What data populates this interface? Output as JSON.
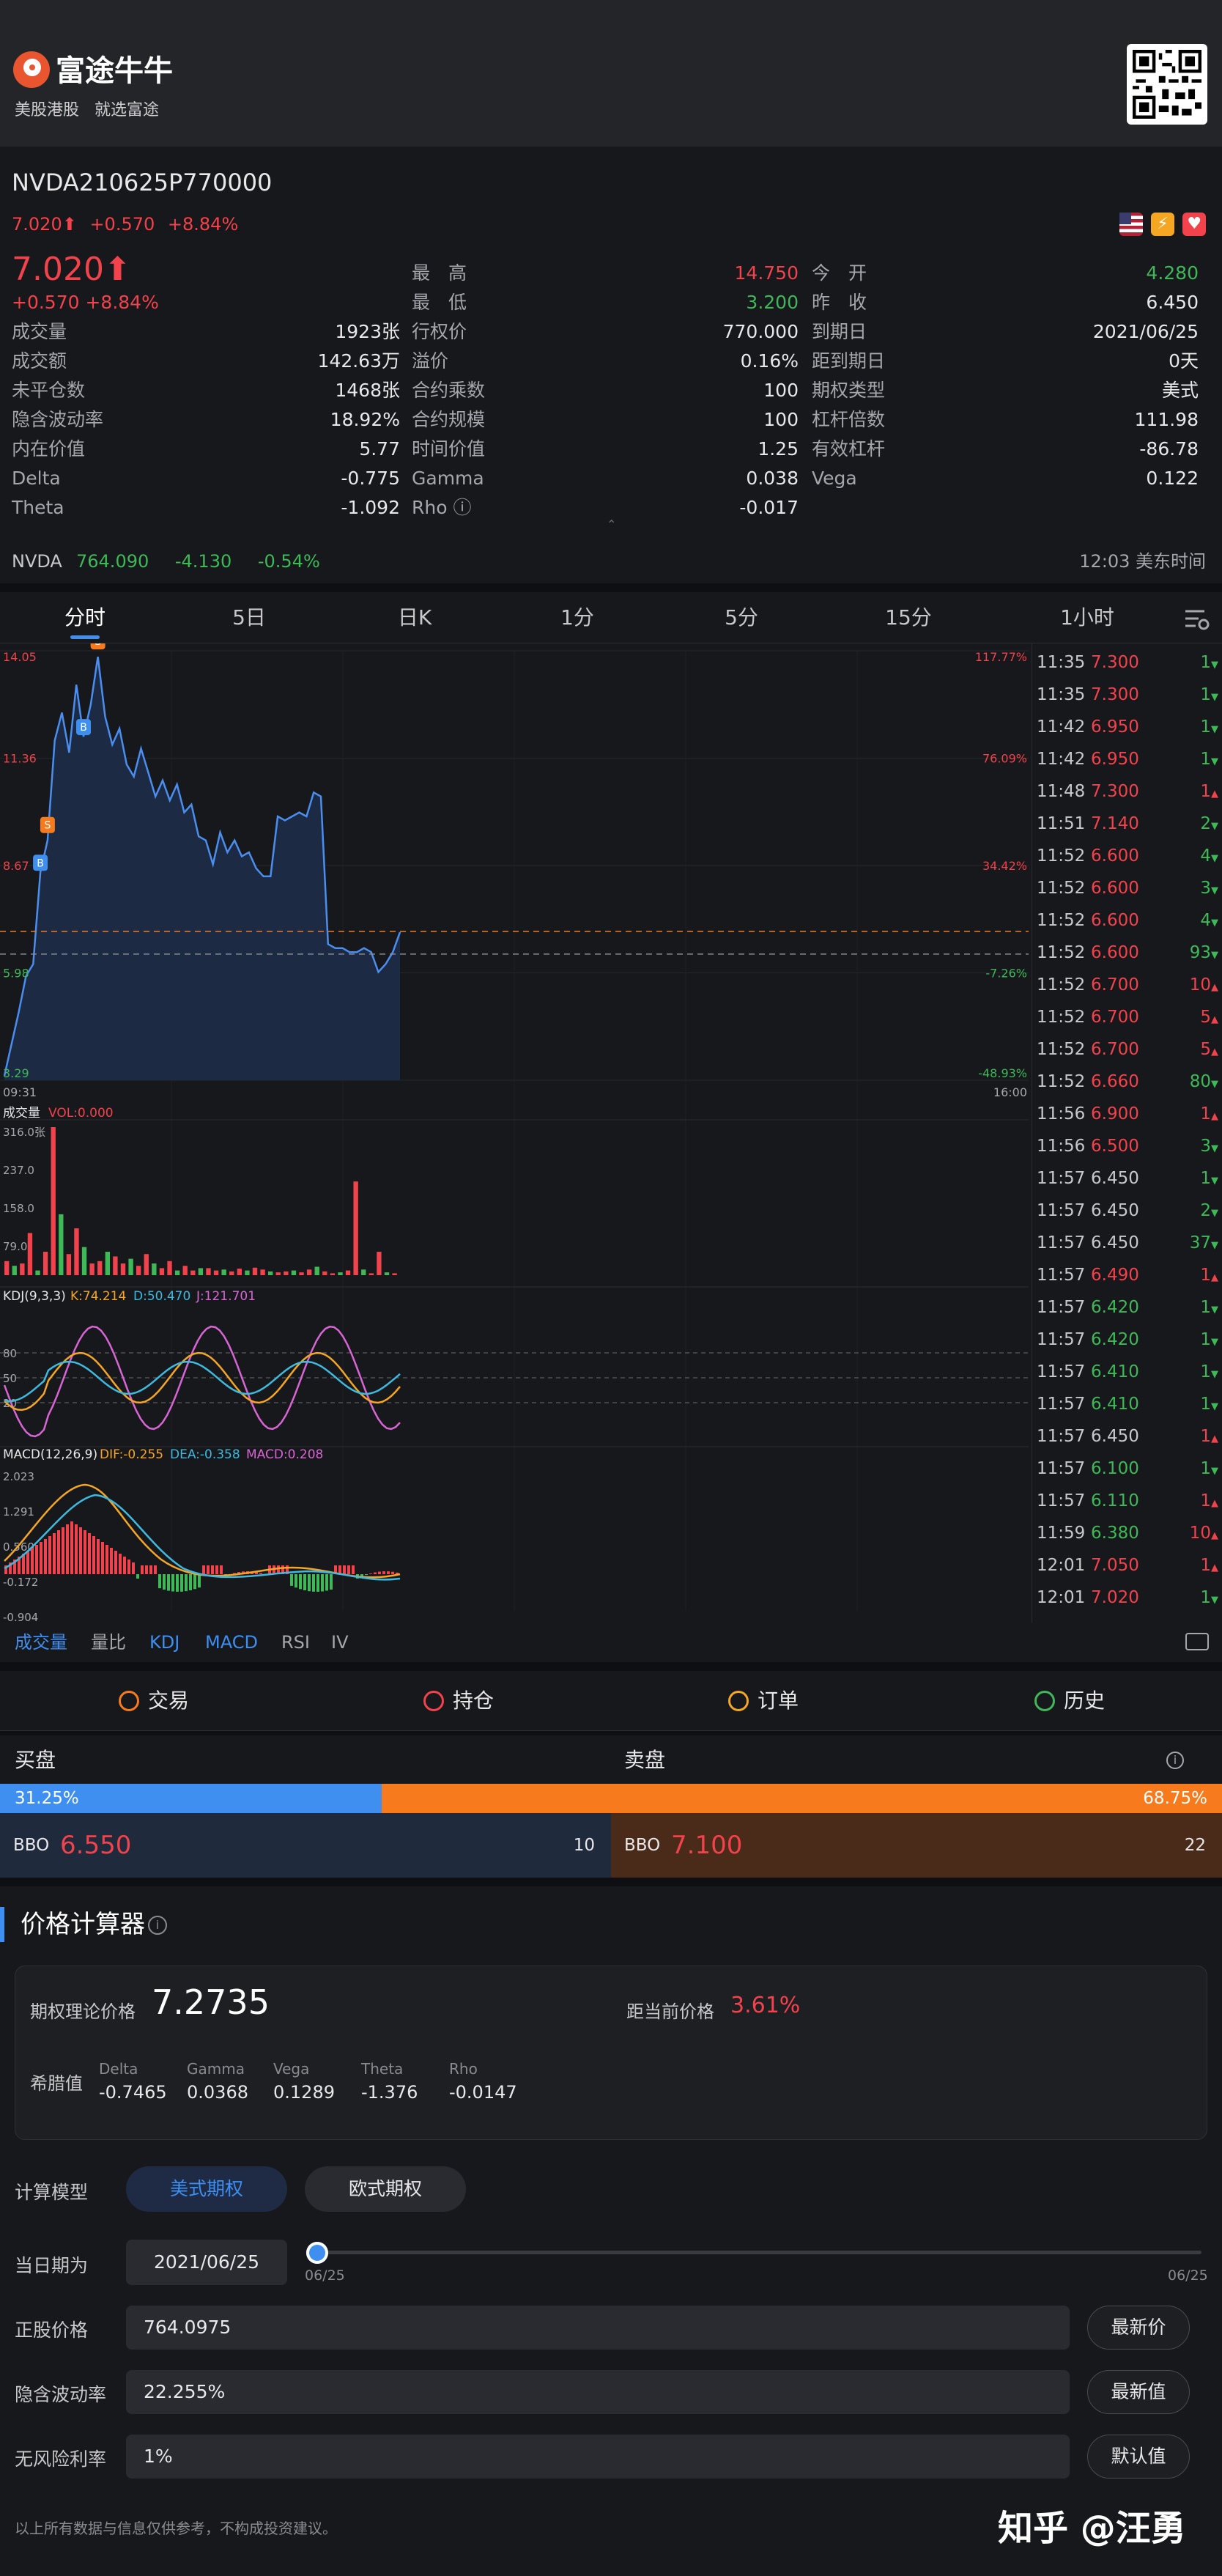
{
  "banner": {
    "brand": "富途牛牛",
    "slogan": "美股港股  就选富途"
  },
  "symbol": {
    "name": "NVDA210625P770000",
    "last_line": "7.020⬆  +0.570  +8.84%",
    "price": "7.020⬆",
    "change": "+0.570 +8.84%"
  },
  "stats": {
    "col1": [
      {
        "label": "成交量",
        "value": "1923张"
      },
      {
        "label": "成交额",
        "value": "142.63万"
      },
      {
        "label": "未平仓数",
        "value": "1468张"
      },
      {
        "label": "隐含波动率",
        "value": "18.92%"
      },
      {
        "label": "内在价值",
        "value": "5.77"
      },
      {
        "label": "Delta",
        "value": "-0.775"
      },
      {
        "label": "Theta",
        "value": "-1.092"
      }
    ],
    "col2": [
      {
        "label": "最　高",
        "value": "14.750",
        "color": "#f2424b"
      },
      {
        "label": "最　低",
        "value": "3.200",
        "color": "#3fb858"
      },
      {
        "label": "行权价",
        "value": "770.000"
      },
      {
        "label": "溢价",
        "value": "0.16%"
      },
      {
        "label": "合约乘数",
        "value": "100"
      },
      {
        "label": "合约规模",
        "value": "100"
      },
      {
        "label": "时间价值",
        "value": "1.25"
      },
      {
        "label": "Gamma",
        "value": "0.038"
      },
      {
        "label": "Rho ⓘ",
        "value": "-0.017"
      }
    ],
    "col3": [
      {
        "label": "今　开",
        "value": "4.280",
        "color": "#3fb858"
      },
      {
        "label": "昨　收",
        "value": "6.450"
      },
      {
        "label": "到期日",
        "value": "2021/06/25"
      },
      {
        "label": "距到期日",
        "value": "0天"
      },
      {
        "label": "期权类型",
        "value": "美式"
      },
      {
        "label": "杠杆倍数",
        "value": "111.98"
      },
      {
        "label": "有效杠杆",
        "value": "-86.78"
      },
      {
        "label": "Vega",
        "value": "0.122"
      }
    ]
  },
  "underlying": {
    "symbol": "NVDA",
    "quote": "764.090  -4.130  -0.54%",
    "time": "12:03 美东时间"
  },
  "chart_tabs": [
    "分时",
    "5日",
    "日K",
    "1分",
    "5分",
    "15分",
    "1小时"
  ],
  "indicator_tabs": [
    "成交量",
    "量比",
    "KDJ",
    "MACD",
    "RSI",
    "IV"
  ],
  "chart_data": {
    "type": "line",
    "title": "",
    "x_range": [
      "09:31",
      "16:00"
    ],
    "price_axis": [
      "14.05",
      "11.36",
      "8.67",
      "5.98",
      "3.29"
    ],
    "pct_axis": [
      "117.77%",
      "76.09%",
      "34.42%",
      "-7.26%",
      "-48.93%"
    ],
    "prev_close": 6.45,
    "series": [
      {
        "values": [
          3.4,
          4.2,
          5.0,
          5.9,
          6.2,
          8.5,
          9.3,
          11.8,
          12.5,
          11.5,
          13.2,
          11.9,
          12.7,
          13.9,
          12.4,
          11.7,
          12.1,
          11.2,
          10.9,
          11.6,
          11.0,
          10.4,
          10.8,
          10.3,
          10.7,
          10.0,
          10.2,
          9.4,
          9.3,
          8.7,
          9.5,
          9.0,
          9.3,
          8.9,
          9.0,
          8.6,
          8.4,
          8.4,
          9.9,
          9.8,
          9.9,
          10.0,
          9.9,
          10.5,
          10.4,
          6.7,
          6.6,
          6.6,
          6.5,
          6.5,
          6.6,
          6.5,
          6.0,
          6.2,
          6.5,
          7.0
        ]
      }
    ],
    "markers": [
      {
        "label": "S",
        "color": "#f77a1c"
      },
      {
        "label": "B",
        "color": "#3e8ff0"
      },
      {
        "label": "S",
        "color": "#f77a1c"
      },
      {
        "label": "B",
        "color": "#3e8ff0"
      }
    ],
    "volume": {
      "label": "成交量",
      "vol_label": "VOL:0.000",
      "axis": [
        "316.0张",
        "237.0",
        "158.0",
        "79.0"
      ],
      "values": [
        30,
        20,
        25,
        90,
        10,
        50,
        316,
        130,
        45,
        100,
        60,
        25,
        30,
        50,
        40,
        25,
        35,
        20,
        45,
        25,
        15,
        30,
        10,
        20,
        10,
        15,
        15,
        10,
        12,
        8,
        14,
        10,
        16,
        12,
        8,
        6,
        8,
        10,
        6,
        12,
        18,
        8,
        4,
        6,
        10,
        200,
        12,
        4,
        50,
        6,
        4
      ]
    },
    "kdj": {
      "label": "KDJ(9,3,3)",
      "k": "K:74.214",
      "d": "D:50.470",
      "j": "J:121.701",
      "axis": [
        "80",
        "50",
        "20"
      ]
    },
    "macd": {
      "label": "MACD(12,26,9)",
      "dif": "DIF:-0.255",
      "dea": "DEA:-0.358",
      "macd": "MACD:0.208",
      "axis": [
        "2.023",
        "1.291",
        "0.560",
        "-0.172",
        "-0.904"
      ]
    }
  },
  "trades": [
    [
      "11:35",
      "7.300",
      "1",
      "down"
    ],
    [
      "11:35",
      "7.300",
      "1",
      "down"
    ],
    [
      "11:42",
      "6.950",
      "1",
      "down"
    ],
    [
      "11:42",
      "6.950",
      "1",
      "down"
    ],
    [
      "11:48",
      "7.300",
      "1",
      "up"
    ],
    [
      "11:51",
      "7.140",
      "2",
      "down"
    ],
    [
      "11:52",
      "6.600",
      "4",
      "down"
    ],
    [
      "11:52",
      "6.600",
      "3",
      "down"
    ],
    [
      "11:52",
      "6.600",
      "4",
      "down"
    ],
    [
      "11:52",
      "6.600",
      "93",
      "down"
    ],
    [
      "11:52",
      "6.700",
      "10",
      "up"
    ],
    [
      "11:52",
      "6.700",
      "5",
      "up"
    ],
    [
      "11:52",
      "6.700",
      "5",
      "up"
    ],
    [
      "11:52",
      "6.660",
      "80",
      "down"
    ],
    [
      "11:56",
      "6.900",
      "1",
      "up"
    ],
    [
      "11:56",
      "6.500",
      "3",
      "down"
    ],
    [
      "11:57",
      "6.450",
      "1",
      "down"
    ],
    [
      "11:57",
      "6.450",
      "2",
      "down"
    ],
    [
      "11:57",
      "6.450",
      "37",
      "down"
    ],
    [
      "11:57",
      "6.490",
      "1",
      "up"
    ],
    [
      "11:57",
      "6.420",
      "1",
      "down"
    ],
    [
      "11:57",
      "6.420",
      "1",
      "down"
    ],
    [
      "11:57",
      "6.410",
      "1",
      "down"
    ],
    [
      "11:57",
      "6.410",
      "1",
      "down"
    ],
    [
      "11:57",
      "6.450",
      "1",
      "up"
    ],
    [
      "11:57",
      "6.100",
      "1",
      "down"
    ],
    [
      "11:57",
      "6.110",
      "1",
      "up"
    ],
    [
      "11:59",
      "6.380",
      "10",
      "up"
    ],
    [
      "12:01",
      "7.050",
      "1",
      "up"
    ],
    [
      "12:01",
      "7.020",
      "1",
      "down"
    ]
  ],
  "actions": [
    "交易",
    "持仓",
    "订单",
    "历史"
  ],
  "orderbook": {
    "bid_label": "买盘",
    "ask_label": "卖盘",
    "bid_pct": "31.25%",
    "ask_pct": "68.75%",
    "bid_ratio": 0.3125,
    "bid": {
      "label": "BBO",
      "price": "6.550",
      "qty": "10"
    },
    "ask": {
      "label": "BBO",
      "price": "7.100",
      "qty": "22"
    }
  },
  "calculator": {
    "title": "价格计算器",
    "theo_label": "期权理论价格",
    "theo_value": "7.2735",
    "dist_label": "距当前价格",
    "dist_value": "3.61%",
    "greek_label": "希腊值",
    "greeks": [
      {
        "name": "Delta",
        "value": "-0.7465"
      },
      {
        "name": "Gamma",
        "value": "0.0368"
      },
      {
        "name": "Vega",
        "value": "0.1289"
      },
      {
        "name": "Theta",
        "value": "-1.376"
      },
      {
        "name": "Rho",
        "value": "-0.0147"
      }
    ],
    "model_label": "计算模型",
    "model_us": "美式期权",
    "model_eu": "欧式期权",
    "date_label": "当日期为",
    "date_value": "2021/06/25",
    "slider_min": "06/25",
    "slider_max": "06/25",
    "spot_label": "正股价格",
    "spot_value": "764.0975",
    "spot_btn": "最新价",
    "iv_label": "隐含波动率",
    "iv_value": "22.255%",
    "iv_btn": "最新值",
    "rate_label": "无风险利率",
    "rate_value": "1%",
    "rate_btn": "默认值"
  },
  "footer": {
    "disclaimer": "以上所有数据与信息仅供参考，不构成投资建议。",
    "watermark": "知乎 @汪勇"
  }
}
